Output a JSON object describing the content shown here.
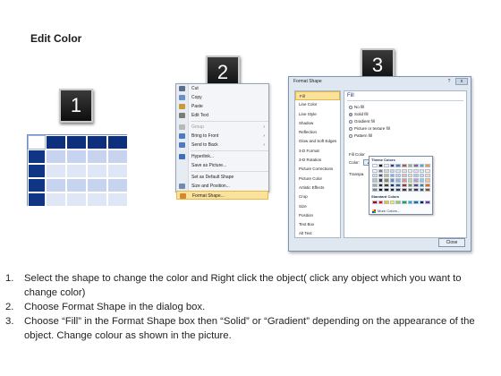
{
  "title": "Edit Color",
  "badges": [
    "1",
    "2",
    "3"
  ],
  "table_colors": {
    "header": "#0d2f7c",
    "body_light": "#dfe7f7",
    "body_mid": "#c7d4ef"
  },
  "context_menu": {
    "items": [
      {
        "label": "Cut",
        "icon": "scissors-icon",
        "enabled": true,
        "submenu": false
      },
      {
        "label": "Copy",
        "icon": "copy-icon",
        "enabled": true,
        "submenu": false
      },
      {
        "label": "Paste",
        "icon": "paste-icon",
        "enabled": true,
        "submenu": false
      },
      {
        "label": "Edit Text",
        "icon": "edit-text-icon",
        "enabled": true,
        "submenu": false
      },
      {
        "sep": true
      },
      {
        "label": "Group",
        "icon": "group-icon",
        "enabled": false,
        "submenu": true
      },
      {
        "label": "Bring to Front",
        "icon": "bring-front-icon",
        "enabled": true,
        "submenu": true
      },
      {
        "label": "Send to Back",
        "icon": "send-back-icon",
        "enabled": true,
        "submenu": true
      },
      {
        "sep": true
      },
      {
        "label": "Hyperlink...",
        "icon": "hyperlink-icon",
        "enabled": true,
        "submenu": false
      },
      {
        "label": "Save as Picture...",
        "icon": "",
        "enabled": true,
        "submenu": false
      },
      {
        "sep": true
      },
      {
        "label": "Set as Default Shape",
        "icon": "",
        "enabled": true,
        "submenu": false
      },
      {
        "label": "Size and Position...",
        "icon": "size-position-icon",
        "enabled": true,
        "submenu": false
      },
      {
        "label": "Format Shape...",
        "icon": "format-shape-icon",
        "enabled": true,
        "submenu": false,
        "highlighted": true
      }
    ]
  },
  "dialog": {
    "title": "Format Shape",
    "help_glyph": "?",
    "close_glyph": "x",
    "nav_items": [
      "Fill",
      "Line Color",
      "Line Style",
      "Shadow",
      "Reflection",
      "Glow and Soft Edges",
      "3-D Format",
      "3-D Rotation",
      "Picture Corrections",
      "Picture Color",
      "Artistic Effects",
      "Crop",
      "Size",
      "Position",
      "Text Box",
      "Alt Text"
    ],
    "nav_selected": "Fill",
    "panel_heading": "Fill",
    "fill_options": [
      {
        "label": "No fill",
        "selected": false
      },
      {
        "label": "Solid fill",
        "selected": true
      },
      {
        "label": "Gradient fill",
        "selected": false
      },
      {
        "label": "Picture or texture fill",
        "selected": false
      },
      {
        "label": "Pattern fill",
        "selected": false
      }
    ],
    "fill_color_label": "Fill Color",
    "color_label": "Color:",
    "transparency_label": "Transpa",
    "close_button": "Close"
  },
  "color_picker": {
    "theme_heading": "Theme Colors",
    "standard_heading": "Standard Colors",
    "more_colors": "More Colors...",
    "theme_top": [
      "#ffffff",
      "#000000",
      "#eeece1",
      "#1f497d",
      "#4f81bd",
      "#c0504d",
      "#9bbb59",
      "#8064a2",
      "#4bacc6",
      "#f79646"
    ],
    "theme_shades": [
      [
        "#f2f2f2",
        "#7f7f7f",
        "#ddd9c3",
        "#c6d9f0",
        "#dbe5f1",
        "#f2dcdb",
        "#ebf1dd",
        "#e5e0ec",
        "#dbeef3",
        "#fdeada"
      ],
      [
        "#d8d8d8",
        "#595959",
        "#c4bd97",
        "#8db3e2",
        "#b8cce4",
        "#e5b9b7",
        "#d7e3bc",
        "#ccc1d9",
        "#b7dde8",
        "#fbd5b5"
      ],
      [
        "#bfbfbf",
        "#3f3f3f",
        "#938953",
        "#548dd4",
        "#95b3d7",
        "#d99694",
        "#c3d69b",
        "#b2a2c7",
        "#92cddc",
        "#fac08f"
      ],
      [
        "#a5a5a5",
        "#262626",
        "#494429",
        "#17365d",
        "#366092",
        "#953734",
        "#76923c",
        "#5f497a",
        "#31859b",
        "#e36c09"
      ],
      [
        "#7f7f7f",
        "#0c0c0c",
        "#1d1b10",
        "#0f243e",
        "#244061",
        "#632423",
        "#4f6128",
        "#3f3151",
        "#205867",
        "#974806"
      ]
    ],
    "standard": [
      "#c00000",
      "#ff0000",
      "#ffc000",
      "#ffff00",
      "#92d050",
      "#00b050",
      "#00b0f0",
      "#0070c0",
      "#002060",
      "#7030a0"
    ]
  },
  "instructions": [
    {
      "num": "1.",
      "text": "Select the shape to change the color and Right click the object( click any object which you want to change color)"
    },
    {
      "num": "2.",
      "text": "Choose Format Shape in the dialog box."
    },
    {
      "num": "3.",
      "text": "Choose “Fill” in the Format Shape box then “Solid” or “Gradient” depending on the appearance of the object. Change colour as shown in the picture."
    }
  ]
}
